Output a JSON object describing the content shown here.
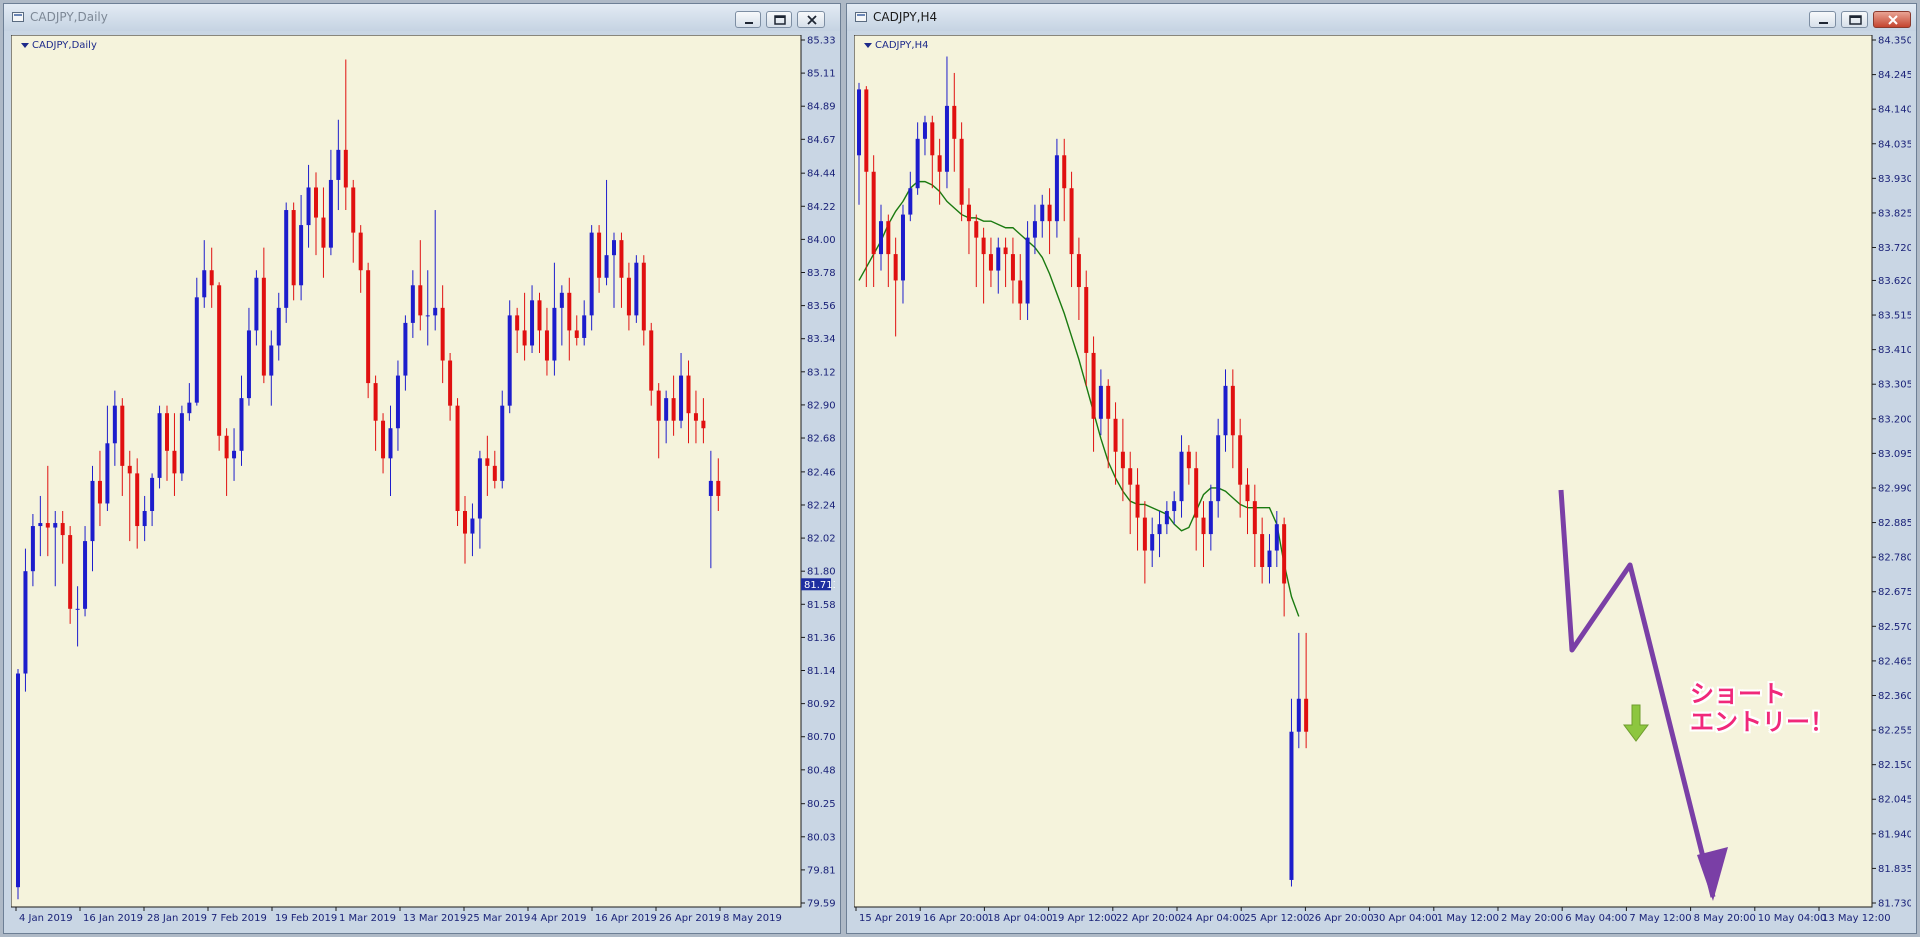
{
  "left_window": {
    "title": "CADJPY,Daily",
    "symbol_label": "CADJPY,Daily",
    "current_price": "81.713"
  },
  "right_window": {
    "title": "CADJPY,H4",
    "symbol_label": "CADJPY,H4",
    "annotation": "ショート\nエントリー！"
  },
  "colors": {
    "background": "#f5f3dc",
    "bull_candle": "#1d1dcc",
    "bear_candle": "#e01010",
    "moving_average": "#1a7a10",
    "drawing_arrow": "#7a3fa6",
    "entry_arrow": "#8dc63f",
    "annotation_text": "#f0287a"
  },
  "icons": [
    "window-app-icon",
    "minimize-icon",
    "restore-icon",
    "close-icon",
    "dropdown-triangle-icon",
    "down-arrow-icon"
  ],
  "chart_data": [
    {
      "type": "candlestick",
      "title": "CADJPY,Daily",
      "ylim": [
        79.595,
        85.33
      ],
      "y_ticks": [
        85.33,
        85.11,
        84.89,
        84.67,
        84.445,
        84.225,
        84.005,
        83.785,
        83.565,
        83.345,
        83.125,
        82.905,
        82.685,
        82.46,
        82.24,
        82.02,
        81.8,
        81.58,
        81.36,
        81.14,
        80.92,
        80.7,
        80.48,
        80.255,
        80.035,
        79.815,
        79.595
      ],
      "x_ticks": [
        "4 Jan 2019",
        "16 Jan 2019",
        "28 Jan 2019",
        "7 Feb 2019",
        "19 Feb 2019",
        "1 Mar 2019",
        "13 Mar 2019",
        "25 Mar 2019",
        "4 Apr 2019",
        "16 Apr 2019",
        "26 Apr 2019",
        "8 May 2019"
      ],
      "current_price": 81.713,
      "candles": [
        [
          79.7,
          81.12,
          81.15,
          79.62
        ],
        [
          81.12,
          81.8,
          81.95,
          81.0
        ],
        [
          81.8,
          82.1,
          82.18,
          81.7
        ],
        [
          82.1,
          82.12,
          82.3,
          81.9
        ],
        [
          82.12,
          82.09,
          82.5,
          81.9
        ],
        [
          82.09,
          82.12,
          82.2,
          81.7
        ],
        [
          82.12,
          82.04,
          82.2,
          81.85
        ],
        [
          82.04,
          81.55,
          82.1,
          81.45
        ],
        [
          81.55,
          81.55,
          81.7,
          81.3
        ],
        [
          81.55,
          82.0,
          82.1,
          81.5
        ],
        [
          82.0,
          82.4,
          82.5,
          81.8
        ],
        [
          82.4,
          82.25,
          82.6,
          82.1
        ],
        [
          82.25,
          82.65,
          82.9,
          82.2
        ],
        [
          82.65,
          82.9,
          83.0,
          82.5
        ],
        [
          82.9,
          82.5,
          82.95,
          82.3
        ],
        [
          82.5,
          82.45,
          82.6,
          82.0
        ],
        [
          82.45,
          82.1,
          82.55,
          81.95
        ],
        [
          82.1,
          82.2,
          82.3,
          82.0
        ],
        [
          82.2,
          82.42,
          82.45,
          82.1
        ],
        [
          82.42,
          82.85,
          82.9,
          82.35
        ],
        [
          82.85,
          82.6,
          82.9,
          82.4
        ],
        [
          82.6,
          82.45,
          82.85,
          82.3
        ],
        [
          82.45,
          82.85,
          82.9,
          82.4
        ],
        [
          82.85,
          82.92,
          83.05,
          82.8
        ],
        [
          82.92,
          83.62,
          83.75,
          82.9
        ],
        [
          83.62,
          83.8,
          84.0,
          83.55
        ],
        [
          83.8,
          83.7,
          83.95,
          83.55
        ],
        [
          83.7,
          82.7,
          83.72,
          82.6
        ],
        [
          82.7,
          82.55,
          82.75,
          82.3
        ],
        [
          82.55,
          82.6,
          82.75,
          82.4
        ],
        [
          82.6,
          82.95,
          83.1,
          82.5
        ],
        [
          82.95,
          83.4,
          83.55,
          82.9
        ],
        [
          83.4,
          83.75,
          83.8,
          83.3
        ],
        [
          83.75,
          83.1,
          83.95,
          83.05
        ],
        [
          83.1,
          83.3,
          83.4,
          82.9
        ],
        [
          83.3,
          83.55,
          83.65,
          83.2
        ],
        [
          83.55,
          84.2,
          84.25,
          83.45
        ],
        [
          84.2,
          83.7,
          84.25,
          83.6
        ],
        [
          83.7,
          84.1,
          84.3,
          83.6
        ],
        [
          84.1,
          84.35,
          84.5,
          83.95
        ],
        [
          84.35,
          84.15,
          84.45,
          83.9
        ],
        [
          84.15,
          83.95,
          84.35,
          83.75
        ],
        [
          83.95,
          84.4,
          84.6,
          83.9
        ],
        [
          84.4,
          84.6,
          84.8,
          84.2
        ],
        [
          84.6,
          84.35,
          85.2,
          84.2
        ],
        [
          84.35,
          84.05,
          84.4,
          83.85
        ],
        [
          84.05,
          83.8,
          84.1,
          83.65
        ],
        [
          83.8,
          83.05,
          83.85,
          82.95
        ],
        [
          83.05,
          82.8,
          83.1,
          82.6
        ],
        [
          82.8,
          82.55,
          82.85,
          82.45
        ],
        [
          82.55,
          82.75,
          82.9,
          82.3
        ],
        [
          82.75,
          83.1,
          83.2,
          82.6
        ],
        [
          83.1,
          83.45,
          83.5,
          83.0
        ],
        [
          83.45,
          83.7,
          83.8,
          83.35
        ],
        [
          83.7,
          83.5,
          84.0,
          83.4
        ],
        [
          83.5,
          83.5,
          83.8,
          83.3
        ],
        [
          83.5,
          83.55,
          84.2,
          83.4
        ],
        [
          83.55,
          83.2,
          83.7,
          83.05
        ],
        [
          83.2,
          82.9,
          83.25,
          82.8
        ],
        [
          82.9,
          82.2,
          82.95,
          82.1
        ],
        [
          82.2,
          82.05,
          82.3,
          81.85
        ],
        [
          82.05,
          82.15,
          82.25,
          81.9
        ],
        [
          82.15,
          82.55,
          82.6,
          81.95
        ],
        [
          82.55,
          82.5,
          82.7,
          82.3
        ],
        [
          82.5,
          82.4,
          82.6,
          82.35
        ],
        [
          82.4,
          82.9,
          83.0,
          82.35
        ],
        [
          82.9,
          83.5,
          83.6,
          82.85
        ],
        [
          83.5,
          83.4,
          83.55,
          83.25
        ],
        [
          83.4,
          83.3,
          83.65,
          83.2
        ],
        [
          83.3,
          83.6,
          83.7,
          83.25
        ],
        [
          83.6,
          83.4,
          83.65,
          83.25
        ],
        [
          83.4,
          83.2,
          83.55,
          83.1
        ],
        [
          83.2,
          83.55,
          83.85,
          83.1
        ],
        [
          83.55,
          83.65,
          83.7,
          83.3
        ],
        [
          83.65,
          83.4,
          83.75,
          83.2
        ],
        [
          83.4,
          83.35,
          83.5,
          83.3
        ],
        [
          83.35,
          83.5,
          83.6,
          83.3
        ],
        [
          83.5,
          84.05,
          84.1,
          83.4
        ],
        [
          84.05,
          83.75,
          84.1,
          83.65
        ],
        [
          83.75,
          83.9,
          84.4,
          83.7
        ],
        [
          83.9,
          84.0,
          84.05,
          83.55
        ],
        [
          84.0,
          83.75,
          84.05,
          83.55
        ],
        [
          83.75,
          83.5,
          83.85,
          83.4
        ],
        [
          83.5,
          83.85,
          83.9,
          83.45
        ],
        [
          83.85,
          83.4,
          83.9,
          83.3
        ],
        [
          83.4,
          83.0,
          83.45,
          82.9
        ],
        [
          83.0,
          82.8,
          83.05,
          82.55
        ],
        [
          82.8,
          82.95,
          83.0,
          82.65
        ],
        [
          82.95,
          82.8,
          83.1,
          82.7
        ],
        [
          82.8,
          83.1,
          83.25,
          82.75
        ],
        [
          83.1,
          82.85,
          83.2,
          82.65
        ],
        [
          82.85,
          82.8,
          83.0,
          82.65
        ],
        [
          82.8,
          82.75,
          82.95,
          82.65
        ],
        [
          82.3,
          82.4,
          82.6,
          81.82
        ],
        [
          82.4,
          82.3,
          82.55,
          82.2
        ]
      ]
    },
    {
      "type": "candlestick",
      "title": "CADJPY,H4",
      "ylim": [
        81.73,
        84.35
      ],
      "y_ticks": [
        84.35,
        84.245,
        84.14,
        84.035,
        83.93,
        83.825,
        83.72,
        83.62,
        83.515,
        83.41,
        83.305,
        83.2,
        83.095,
        82.99,
        82.885,
        82.78,
        82.675,
        82.57,
        82.465,
        82.36,
        82.255,
        82.15,
        82.045,
        81.94,
        81.835,
        81.73
      ],
      "x_ticks": [
        "15 Apr 2019",
        "16 Apr 20:00",
        "18 Apr 04:00",
        "19 Apr 12:00",
        "22 Apr 20:00",
        "24 Apr 04:00",
        "25 Apr 12:00",
        "26 Apr 20:00",
        "30 Apr 04:00",
        "1 May 12:00",
        "2 May 20:00",
        "6 May 04:00",
        "7 May 12:00",
        "8 May 20:00",
        "10 May 04:00",
        "13 May 12:00"
      ],
      "moving_average": [
        83.62,
        83.66,
        83.7,
        83.74,
        83.79,
        83.83,
        83.86,
        83.9,
        83.92,
        83.92,
        83.91,
        83.89,
        83.86,
        83.84,
        83.82,
        83.81,
        83.81,
        83.8,
        83.8,
        83.79,
        83.78,
        83.78,
        83.76,
        83.74,
        83.72,
        83.69,
        83.64,
        83.58,
        83.52,
        83.45,
        83.38,
        83.3,
        83.22,
        83.14,
        83.07,
        83.02,
        82.98,
        82.95,
        82.94,
        82.94,
        82.93,
        82.92,
        82.91,
        82.88,
        82.86,
        82.87,
        82.92,
        82.97,
        82.99,
        82.99,
        82.98,
        82.96,
        82.94,
        82.93,
        82.93,
        82.93,
        82.93,
        82.88,
        82.76,
        82.66,
        82.6
      ],
      "candles": [
        [
          84.0,
          84.2,
          84.22,
          83.85
        ],
        [
          84.2,
          83.95,
          84.21,
          83.6
        ],
        [
          83.95,
          83.7,
          84.0,
          83.6
        ],
        [
          83.7,
          83.8,
          83.85,
          83.65
        ],
        [
          83.8,
          83.7,
          83.82,
          83.6
        ],
        [
          83.7,
          83.62,
          83.75,
          83.45
        ],
        [
          83.62,
          83.82,
          83.85,
          83.55
        ],
        [
          83.82,
          83.9,
          83.95,
          83.8
        ],
        [
          83.9,
          84.05,
          84.1,
          83.88
        ],
        [
          84.05,
          84.1,
          84.12,
          84.0
        ],
        [
          84.1,
          84.0,
          84.12,
          83.9
        ],
        [
          84.0,
          83.95,
          84.05,
          83.85
        ],
        [
          83.95,
          84.15,
          84.3,
          83.9
        ],
        [
          84.15,
          84.05,
          84.25,
          83.95
        ],
        [
          84.05,
          83.85,
          84.1,
          83.8
        ],
        [
          83.85,
          83.8,
          83.9,
          83.7
        ],
        [
          83.8,
          83.75,
          83.82,
          83.6
        ],
        [
          83.75,
          83.7,
          83.78,
          83.55
        ],
        [
          83.7,
          83.65,
          83.75,
          83.6
        ],
        [
          83.65,
          83.72,
          83.75,
          83.58
        ],
        [
          83.72,
          83.7,
          83.75,
          83.6
        ],
        [
          83.7,
          83.62,
          83.75,
          83.55
        ],
        [
          83.62,
          83.55,
          83.7,
          83.5
        ],
        [
          83.55,
          83.75,
          83.8,
          83.5
        ],
        [
          83.75,
          83.8,
          83.85,
          83.7
        ],
        [
          83.8,
          83.85,
          83.88,
          83.75
        ],
        [
          83.85,
          83.8,
          83.9,
          83.7
        ],
        [
          83.8,
          84.0,
          84.05,
          83.75
        ],
        [
          84.0,
          83.9,
          84.05,
          83.8
        ],
        [
          83.9,
          83.7,
          83.95,
          83.6
        ],
        [
          83.7,
          83.6,
          83.75,
          83.5
        ],
        [
          83.6,
          83.4,
          83.65,
          83.3
        ],
        [
          83.4,
          83.2,
          83.45,
          83.1
        ],
        [
          83.2,
          83.3,
          83.35,
          83.15
        ],
        [
          83.3,
          83.2,
          83.32,
          83.05
        ],
        [
          83.2,
          83.1,
          83.25,
          83.0
        ],
        [
          83.1,
          83.05,
          83.2,
          82.95
        ],
        [
          83.05,
          83.0,
          83.1,
          82.85
        ],
        [
          83.0,
          82.9,
          83.05,
          82.8
        ],
        [
          82.9,
          82.8,
          82.95,
          82.7
        ],
        [
          82.8,
          82.85,
          82.9,
          82.75
        ],
        [
          82.85,
          82.88,
          82.92,
          82.78
        ],
        [
          82.88,
          82.92,
          82.95,
          82.85
        ],
        [
          82.92,
          82.95,
          82.98,
          82.88
        ],
        [
          82.95,
          83.1,
          83.15,
          82.9
        ],
        [
          83.1,
          83.05,
          83.12,
          83.0
        ],
        [
          83.05,
          82.9,
          83.1,
          82.8
        ],
        [
          82.9,
          82.85,
          82.95,
          82.75
        ],
        [
          82.85,
          82.95,
          83.0,
          82.8
        ],
        [
          82.95,
          83.15,
          83.2,
          82.9
        ],
        [
          83.15,
          83.3,
          83.35,
          83.1
        ],
        [
          83.3,
          83.15,
          83.35,
          83.05
        ],
        [
          83.15,
          83.0,
          83.2,
          82.9
        ],
        [
          83.0,
          82.95,
          83.05,
          82.85
        ],
        [
          82.95,
          82.85,
          83.0,
          82.75
        ],
        [
          82.85,
          82.75,
          82.9,
          82.7
        ],
        [
          82.75,
          82.8,
          82.85,
          82.7
        ],
        [
          82.8,
          82.88,
          82.92,
          82.75
        ],
        [
          82.88,
          82.7,
          82.9,
          82.6
        ],
        [
          81.8,
          82.25,
          82.35,
          81.78
        ],
        [
          82.25,
          82.35,
          82.55,
          82.2
        ],
        [
          82.35,
          82.25,
          82.55,
          82.2
        ]
      ]
    }
  ]
}
